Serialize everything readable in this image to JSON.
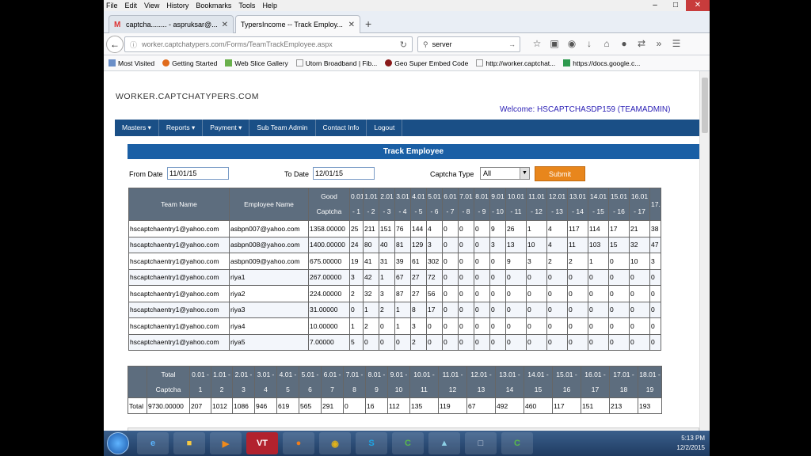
{
  "browser": {
    "menu": [
      "File",
      "Edit",
      "View",
      "History",
      "Bookmarks",
      "Tools",
      "Help"
    ],
    "tabs": [
      {
        "label": "captcha........ - aspruksar@...",
        "icon": "gmail-icon"
      },
      {
        "label": "TypersIncome -- Track Employ...",
        "icon": "page-icon"
      }
    ],
    "url": "worker.captchatypers.com/Forms/TeamTrackEmployee.aspx",
    "search_value": "server",
    "bookmarks": [
      "Most Visited",
      "Getting Started",
      "Web Slice Gallery",
      "Utorn Broadband | Fib...",
      "Geo Super Embed Code",
      "http://worker.captchat...",
      "https://docs.google.c..."
    ]
  },
  "site": {
    "title": "WORKER.CAPTCHATYPERS.COM",
    "welcome": "Welcome: HSCAPTCHASDP159 (TEAMADMIN)",
    "nav": [
      "Masters ▾",
      "Reports ▾",
      "Payment ▾",
      "Sub Team Admin",
      "Contact Info",
      "Logout"
    ]
  },
  "panel": {
    "title": "Track Employee",
    "from_label": "From Date",
    "from_value": "11/01/15",
    "to_label": "To Date",
    "to_value": "12/01/15",
    "type_label": "Captcha Type",
    "type_value": "All",
    "submit": "Submit"
  },
  "grid": {
    "headers": [
      "Team Name",
      "Employee Name",
      "Good Captcha",
      "0.01 - 1",
      "1.01 - 2",
      "2.01 - 3",
      "3.01 - 4",
      "4.01 - 5",
      "5.01 - 6",
      "6.01 - 7",
      "7.01 - 8",
      "8.01 - 9",
      "9.01 - 10",
      "10.01 - 11",
      "11.01 - 12",
      "12.01 - 13",
      "13.01 - 14",
      "14.01 - 15",
      "15.01 - 16",
      "16.01 - 17",
      "17."
    ],
    "rows": [
      [
        "hscaptchaentry1@yahoo.com",
        "asbpn007@yahoo.com",
        "1358.00000",
        "25",
        "211",
        "151",
        "76",
        "144",
        "4",
        "0",
        "0",
        "0",
        "9",
        "26",
        "1",
        "4",
        "117",
        "114",
        "17",
        "21",
        "38"
      ],
      [
        "hscaptchaentry1@yahoo.com",
        "asbpn008@yahoo.com",
        "1400.00000",
        "24",
        "80",
        "40",
        "81",
        "129",
        "3",
        "0",
        "0",
        "0",
        "3",
        "13",
        "10",
        "4",
        "11",
        "103",
        "15",
        "32",
        "47"
      ],
      [
        "hscaptchaentry1@yahoo.com",
        "asbpn009@yahoo.com",
        "675.00000",
        "19",
        "41",
        "31",
        "39",
        "61",
        "302",
        "0",
        "0",
        "0",
        "0",
        "9",
        "3",
        "2",
        "2",
        "1",
        "0",
        "10",
        "3"
      ],
      [
        "hscaptchaentry1@yahoo.com",
        "riya1",
        "267.00000",
        "3",
        "42",
        "1",
        "67",
        "27",
        "72",
        "0",
        "0",
        "0",
        "0",
        "0",
        "0",
        "0",
        "0",
        "0",
        "0",
        "0",
        "0"
      ],
      [
        "hscaptchaentry1@yahoo.com",
        "riya2",
        "224.00000",
        "2",
        "32",
        "3",
        "87",
        "27",
        "56",
        "0",
        "0",
        "0",
        "0",
        "0",
        "0",
        "0",
        "0",
        "0",
        "0",
        "0",
        "0"
      ],
      [
        "hscaptchaentry1@yahoo.com",
        "riya3",
        "31.00000",
        "0",
        "1",
        "2",
        "1",
        "8",
        "17",
        "0",
        "0",
        "0",
        "0",
        "0",
        "0",
        "0",
        "0",
        "0",
        "0",
        "0",
        "0"
      ],
      [
        "hscaptchaentry1@yahoo.com",
        "riya4",
        "10.00000",
        "1",
        "2",
        "0",
        "1",
        "3",
        "0",
        "0",
        "0",
        "0",
        "0",
        "0",
        "0",
        "0",
        "0",
        "0",
        "0",
        "0",
        "0"
      ],
      [
        "hscaptchaentry1@yahoo.com",
        "riya5",
        "7.00000",
        "5",
        "0",
        "0",
        "0",
        "2",
        "0",
        "0",
        "0",
        "0",
        "0",
        "0",
        "0",
        "0",
        "0",
        "0",
        "0",
        "0",
        "0"
      ]
    ]
  },
  "totals": {
    "headers": [
      "",
      "Total Captcha",
      "0.01 - 1",
      "1.01 - 2",
      "2.01 - 3",
      "3.01 - 4",
      "4.01 - 5",
      "5.01 - 6",
      "6.01 - 7",
      "7.01 - 8",
      "8.01 - 9",
      "9.01 - 10",
      "10.01 - 11",
      "11.01 - 12",
      "12.01 - 13",
      "13.01 - 14",
      "14.01 - 15",
      "15.01 - 16",
      "16.01 - 17",
      "17.01 - 18",
      "18.01 - 19"
    ],
    "row": [
      "Total",
      "9730.00000",
      "207",
      "1012",
      "1086",
      "946",
      "619",
      "565",
      "291",
      "0",
      "16",
      "112",
      "135",
      "119",
      "67",
      "492",
      "460",
      "117",
      "151",
      "213",
      "193"
    ]
  },
  "taskbar": {
    "apps": [
      "ie-icon",
      "folder-icon",
      "media-icon",
      "VT",
      "firefox-icon",
      "chrome-icon",
      "skype-icon",
      "camtasia-icon",
      "app-icon",
      "paint-icon",
      "camtasia2-icon"
    ],
    "time": "5:13 PM",
    "date": "12/2/2015"
  }
}
